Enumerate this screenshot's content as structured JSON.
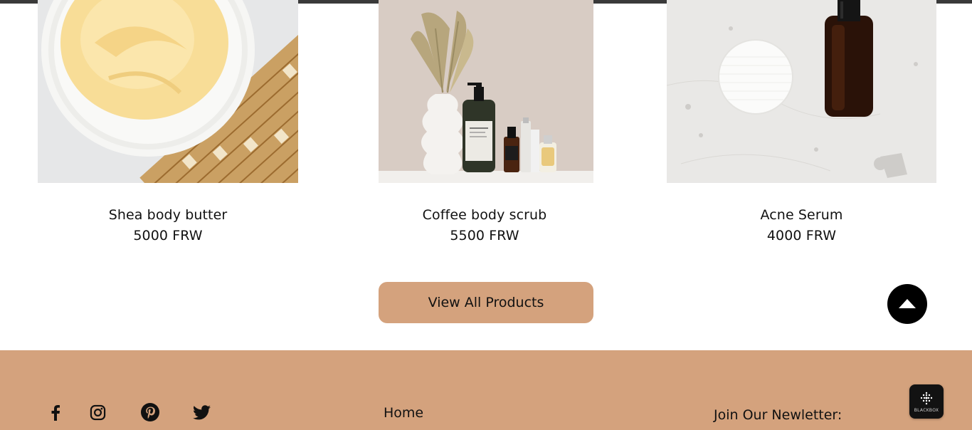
{
  "products": [
    {
      "name": "Shea body butter",
      "price": "5000 FRW",
      "image_icon": "shea-butter-photo"
    },
    {
      "name": "Coffee body scrub",
      "price": "5500 FRW",
      "image_icon": "coffee-scrub-photo"
    },
    {
      "name": "Acne Serum",
      "price": "4000 FRW",
      "image_icon": "acne-serum-photo"
    }
  ],
  "view_all_label": "View All Products",
  "back_to_top_icon": "arrow-up-icon",
  "footer": {
    "social": [
      "facebook-icon",
      "instagram-icon",
      "pinterest-icon",
      "twitter-icon"
    ],
    "nav_home": "Home",
    "newsletter_label": "Join Our Newletter:"
  },
  "widget": {
    "label": "BLACKBOX"
  },
  "colors": {
    "accent": "#d4a27d",
    "text": "#111111",
    "top_rule": "#3a3a3a"
  }
}
